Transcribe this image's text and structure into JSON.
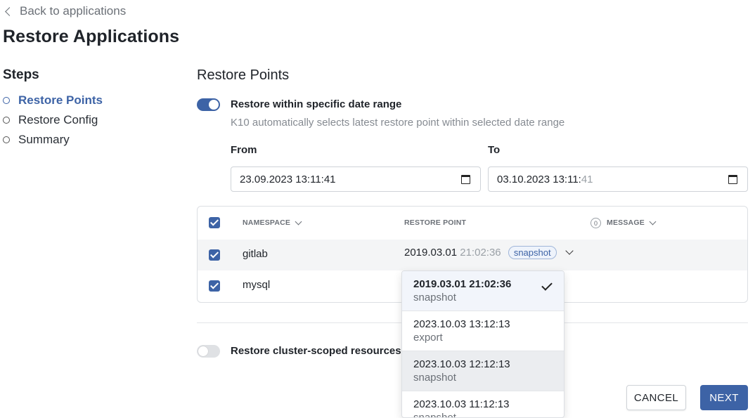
{
  "nav": {
    "back_label": "Back to applications"
  },
  "page": {
    "title": "Restore Applications"
  },
  "steps": {
    "title": "Steps",
    "items": [
      {
        "label": "Restore Points",
        "active": true
      },
      {
        "label": "Restore Config",
        "active": false
      },
      {
        "label": "Summary",
        "active": false
      }
    ]
  },
  "restore_points": {
    "title": "Restore Points",
    "date_range_toggle": {
      "label": "Restore within specific date range",
      "on": true
    },
    "hint": "K10 automatically selects latest restore point within selected date range",
    "from": {
      "label": "From",
      "value_main": "23.09.2023 13:11:41",
      "value_light": ""
    },
    "to": {
      "label": "To",
      "value_main": "03.10.2023 13:11:",
      "value_light": "41"
    }
  },
  "table": {
    "headers": {
      "namespace": "NAMESPACE",
      "restore_point": "RESTORE POINT",
      "message_count": "0",
      "message": "MESSAGE"
    },
    "rows": [
      {
        "namespace": "gitlab",
        "rp_date": "2019.03.01",
        "rp_time": "21:02:36",
        "rp_tag": "snapshot",
        "checked": true
      },
      {
        "namespace": "mysql",
        "checked": true
      }
    ]
  },
  "dropdown": {
    "options": [
      {
        "datetime": "2019.03.01 21:02:36",
        "type": "snapshot",
        "selected": true
      },
      {
        "datetime": "2023.10.03 13:12:13",
        "type": "export"
      },
      {
        "datetime": "2023.10.03 12:12:13",
        "type": "snapshot",
        "hover": true
      },
      {
        "datetime": "2023.10.03 11:12:13",
        "type": "snapshot"
      }
    ]
  },
  "cluster_toggle": {
    "label": "Restore cluster-scoped resources",
    "on": false
  },
  "buttons": {
    "cancel": "CANCEL",
    "next": "NEXT"
  },
  "colors": {
    "accent": "#3d63a6",
    "tag_bg": "#eef3fb",
    "hover_bg": "#ebedf0"
  }
}
